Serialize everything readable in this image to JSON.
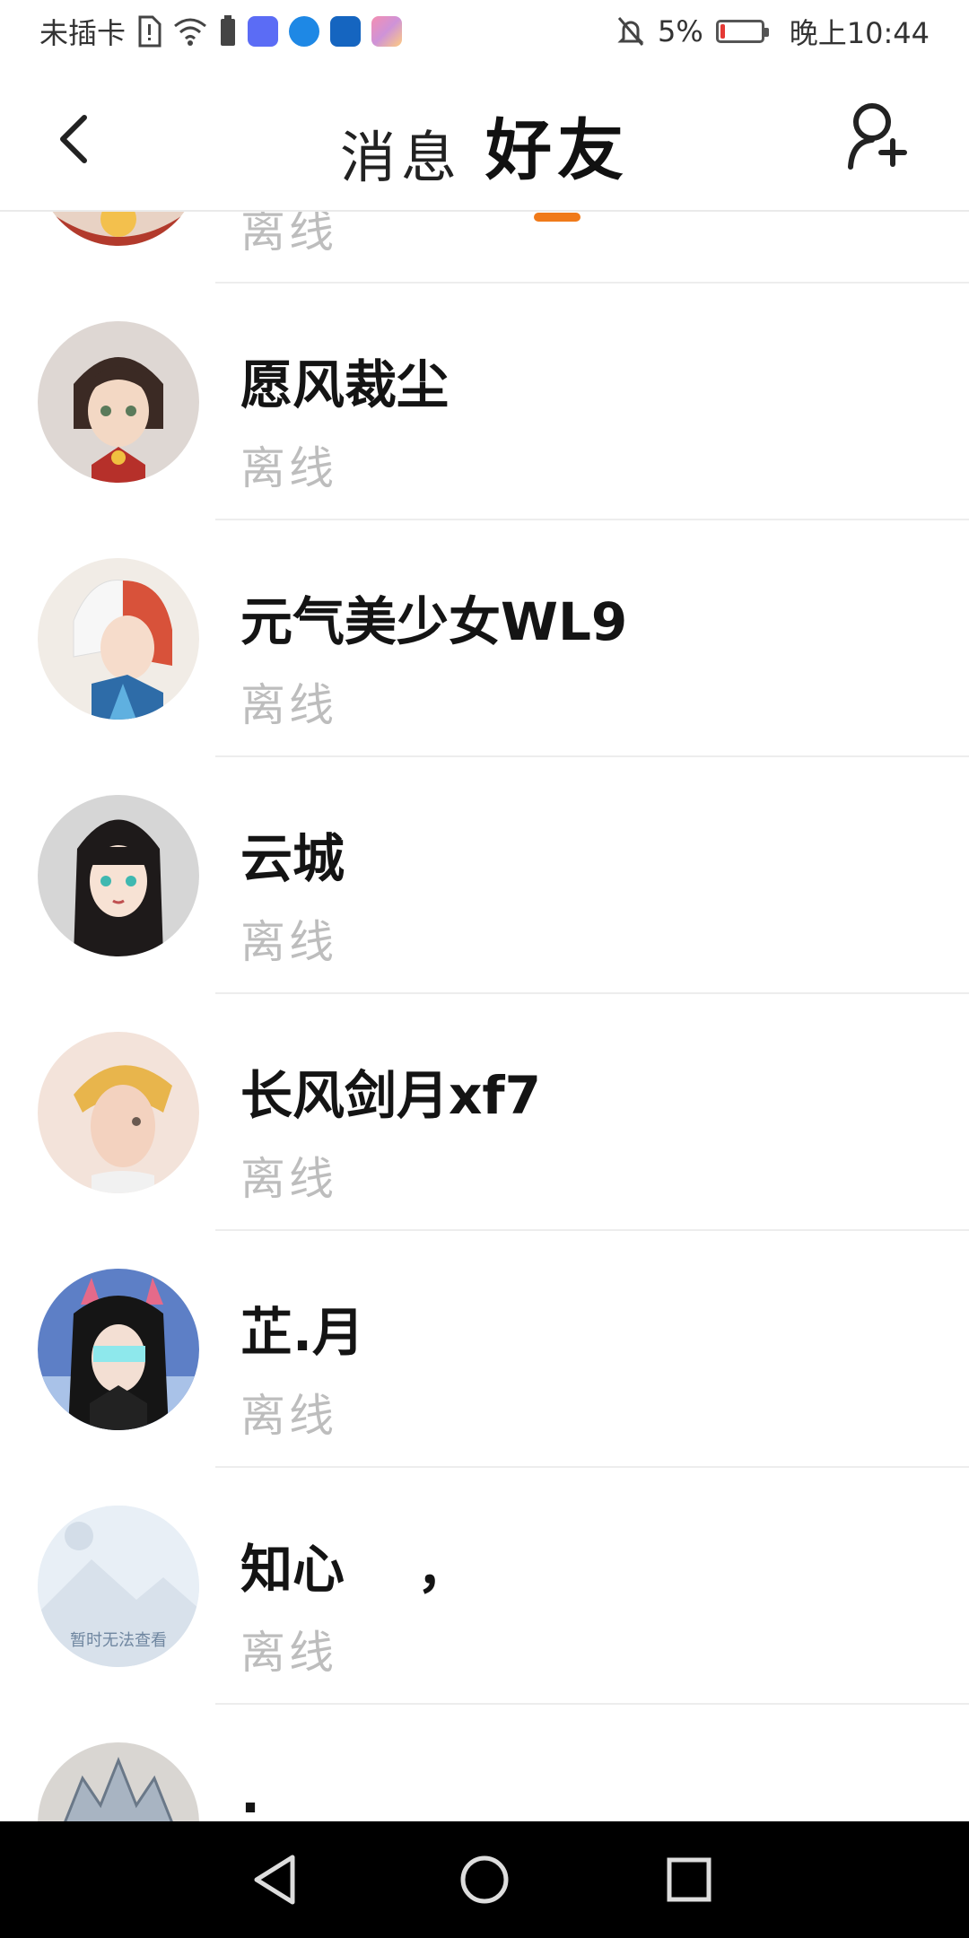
{
  "status_bar": {
    "carrier": "未插卡",
    "battery_percent_label": "5%",
    "battery_level": 0.05,
    "time": "晚上10:44",
    "icons": [
      "sim-alert-icon",
      "wifi-icon",
      "battery-saver-icon",
      "music-app-icon",
      "browser-app-icon",
      "weather-app-icon",
      "gallery-app-icon",
      "mute-icon",
      "battery-icon"
    ]
  },
  "header": {
    "tab_messages": "消息",
    "tab_friends": "好友",
    "active_tab": "friends",
    "accent_color": "#f07a1a"
  },
  "friends": [
    {
      "name": "",
      "status": "离线",
      "avatar": "avatar-partial-top"
    },
    {
      "name": "愿风裁尘",
      "status": "离线",
      "avatar": "avatar-short-hair-girl"
    },
    {
      "name": "元气美少女WL9",
      "status": "离线",
      "avatar": "avatar-red-white-hair"
    },
    {
      "name": "云城",
      "status": "离线",
      "avatar": "avatar-black-long-hair"
    },
    {
      "name": "长风剑月xf7",
      "status": "离线",
      "avatar": "avatar-blonde-boy"
    },
    {
      "name": "芷.月",
      "status": "离线",
      "avatar": "avatar-cat-ear-girl"
    },
    {
      "name": "知心    ，",
      "status": "离线",
      "avatar": "avatar-placeholder"
    },
    {
      "name": ".",
      "status": "",
      "avatar": "avatar-silver-hair"
    }
  ],
  "placeholder_avatar_text": "暂时无法查看",
  "nav_bar": {
    "icons": [
      "back-triangle-icon",
      "home-circle-icon",
      "recents-square-icon"
    ]
  }
}
